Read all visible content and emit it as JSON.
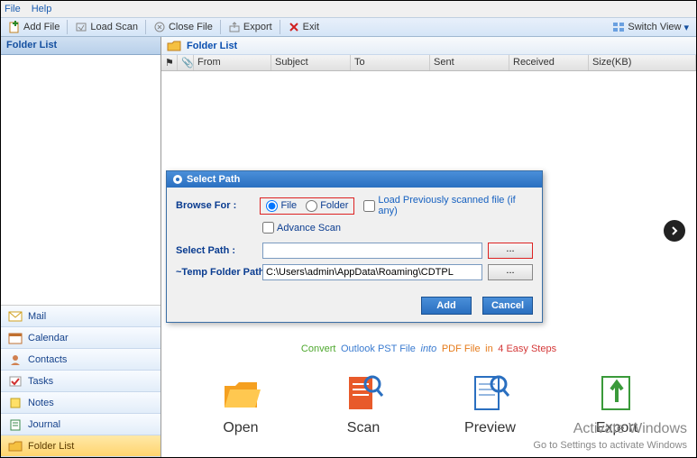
{
  "menu": {
    "file": "File",
    "help": "Help"
  },
  "toolbar": {
    "add_file": "Add File",
    "load_scan": "Load Scan",
    "close_file": "Close File",
    "export": "Export",
    "exit": "Exit",
    "switch_view": "Switch View"
  },
  "left": {
    "header": "Folder List",
    "nav": {
      "mail": "Mail",
      "calendar": "Calendar",
      "contacts": "Contacts",
      "tasks": "Tasks",
      "notes": "Notes",
      "journal": "Journal",
      "folder_list": "Folder List"
    }
  },
  "right": {
    "header": "Folder List",
    "columns": {
      "from": "From",
      "subject": "Subject",
      "to": "To",
      "sent": "Sent",
      "received": "Received",
      "size": "Size(KB)"
    }
  },
  "dialog": {
    "title": "Select Path",
    "browse_for": "Browse For :",
    "opt_file": "File",
    "opt_folder": "Folder",
    "load_prev": "Load Previously scanned file (if any)",
    "advance_scan": "Advance Scan",
    "select_path": "Select Path :",
    "select_path_value": "",
    "temp_path": "~Temp Folder Path :",
    "temp_path_value": "C:\\Users\\admin\\AppData\\Roaming\\CDTPL",
    "browse": "...",
    "add": "Add",
    "cancel": "Cancel"
  },
  "promo": {
    "w1": "Convert",
    "w2": "Outlook PST File",
    "w3": "into",
    "w4": "PDF File",
    "w5": "in",
    "w6": "4 Easy Steps",
    "steps": {
      "open": "Open",
      "scan": "Scan",
      "preview": "Preview",
      "export": "Export"
    }
  },
  "watermark": {
    "l1": "Activate Windows",
    "l2": "Go to Settings to activate Windows"
  }
}
